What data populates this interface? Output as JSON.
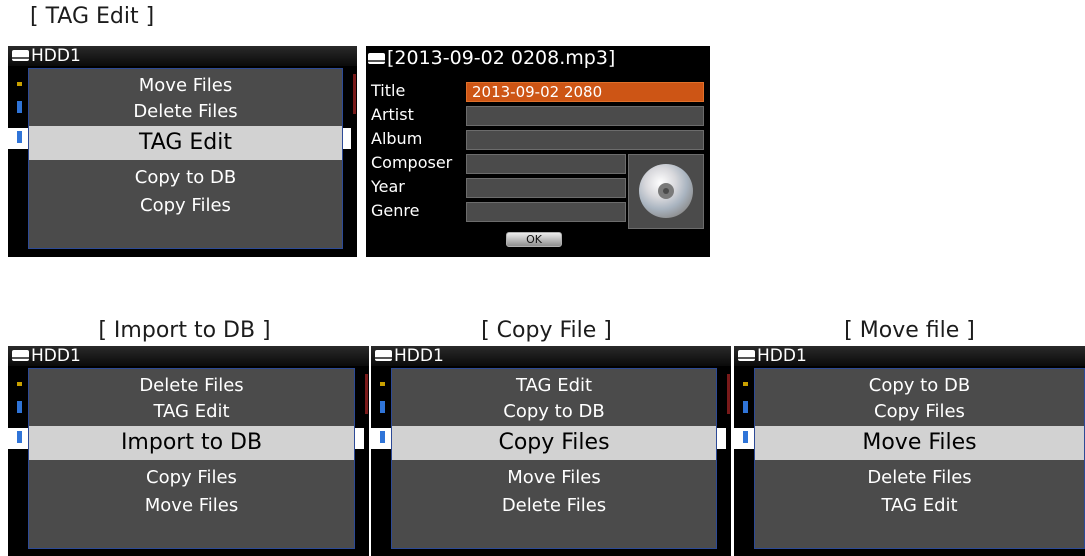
{
  "captions": {
    "tag_edit": "[ TAG Edit ]",
    "import_to_db": "[ Import to DB ]",
    "copy_file": "[ Copy File ]",
    "move_file": "[ Move file ]"
  },
  "device_label": "HDD1",
  "menus": {
    "tag_edit": [
      "Move Files",
      "Delete Files",
      "TAG Edit",
      "Copy to DB",
      "Copy Files"
    ],
    "import_to_db": [
      "Delete Files",
      "TAG Edit",
      "Import to DB",
      "Copy Files",
      "Move Files"
    ],
    "copy_file": [
      "TAG Edit",
      "Copy to DB",
      "Copy Files",
      "Move Files",
      "Delete Files"
    ],
    "move_file": [
      "Copy to DB",
      "Copy Files",
      "Move Files",
      "Delete Files",
      "TAG Edit"
    ]
  },
  "selected_index": 2,
  "tag_dialog": {
    "file_name": "[2013-09-02 0208.mp3]",
    "fields": [
      {
        "label": "Title",
        "value": "2013-09-02 2080",
        "active": true
      },
      {
        "label": "Artist",
        "value": ""
      },
      {
        "label": "Album",
        "value": ""
      },
      {
        "label": "Composer",
        "value": ""
      },
      {
        "label": "Year",
        "value": ""
      },
      {
        "label": "Genre",
        "value": ""
      }
    ],
    "ok_label": "OK",
    "album_art_icon": "cd-disc-icon"
  },
  "colors": {
    "screen_bg": "#000000",
    "popup_bg": "#4b4b4b",
    "popup_border": "#2d4a96",
    "selected_bg": "#d2d2d2",
    "active_field": "#cd5515"
  }
}
